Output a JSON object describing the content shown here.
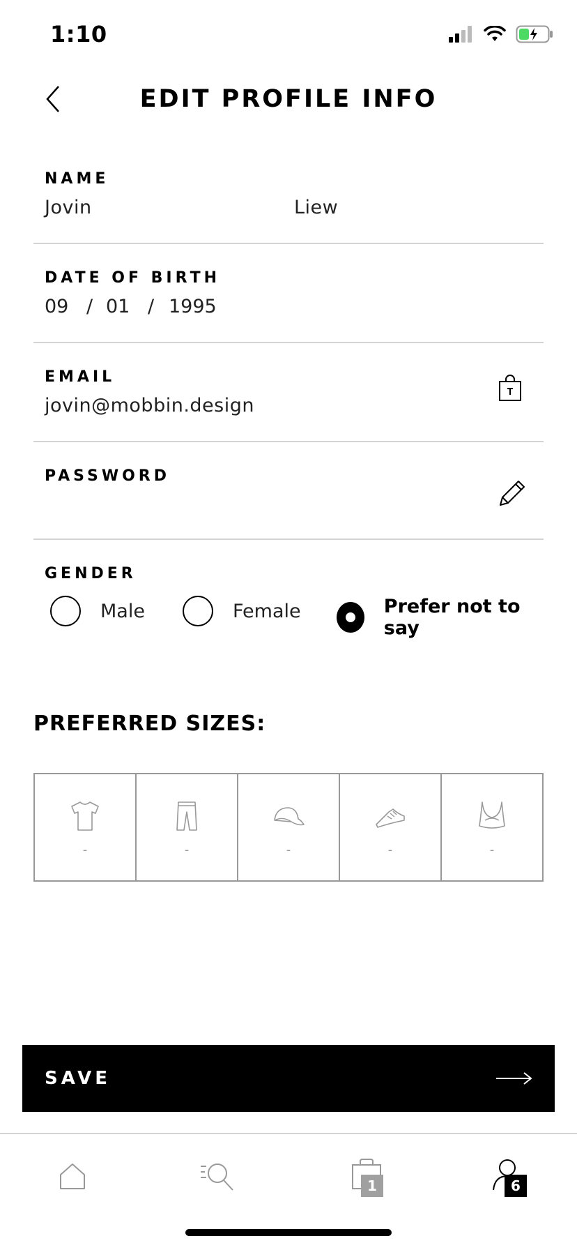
{
  "status_bar": {
    "time": "1:10"
  },
  "header": {
    "title": "EDIT PROFILE INFO"
  },
  "form": {
    "name": {
      "label": "NAME",
      "first": "Jovin",
      "last": "Liew"
    },
    "dob": {
      "label": "DATE OF BIRTH",
      "day": "09",
      "month": "01",
      "year": "1995",
      "separator": "/"
    },
    "email": {
      "label": "EMAIL",
      "value": "jovin@mobbin.design"
    },
    "password": {
      "label": "PASSWORD"
    },
    "gender": {
      "label": "GENDER",
      "options": [
        "Male",
        "Female",
        "Prefer not to say"
      ],
      "selected": "Prefer not to say"
    }
  },
  "sizes": {
    "title": "PREFERRED SIZES:",
    "items": [
      {
        "icon": "tshirt-icon",
        "value": "-"
      },
      {
        "icon": "pants-icon",
        "value": "-"
      },
      {
        "icon": "cap-icon",
        "value": "-"
      },
      {
        "icon": "shoe-icon",
        "value": "-"
      },
      {
        "icon": "sports-bra-icon",
        "value": "-"
      }
    ]
  },
  "save_button": {
    "label": "SAVE"
  },
  "tab_bar": {
    "bag_badge": "1",
    "profile_badge": "6"
  }
}
